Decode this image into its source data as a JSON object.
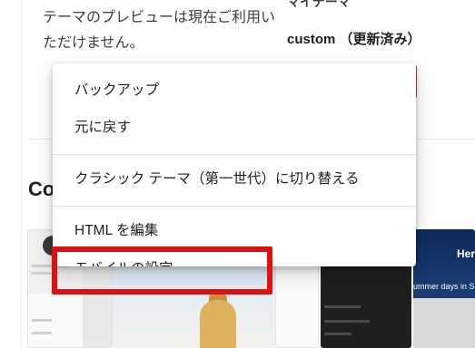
{
  "background": {
    "preview_note": "テーマのプレビューは現在ご利用いただけません。",
    "my_theme_label": "マイテーマ",
    "theme_name": "custom （更新済み）",
    "section_heading_partial": "Co"
  },
  "thumbnails": {
    "here_text": "Here",
    "caption_text": "ummer days in Santorini"
  },
  "menu": {
    "items": [
      {
        "label": "バックアップ"
      },
      {
        "label": "元に戻す"
      },
      {
        "label": "クラシック テーマ（第一世代）に切り替える"
      },
      {
        "label": "HTML を編集"
      },
      {
        "label": "モバイルの設定"
      }
    ]
  },
  "colors": {
    "highlight": "#e01010",
    "accent_red": "#d93025",
    "text": "#202124"
  }
}
